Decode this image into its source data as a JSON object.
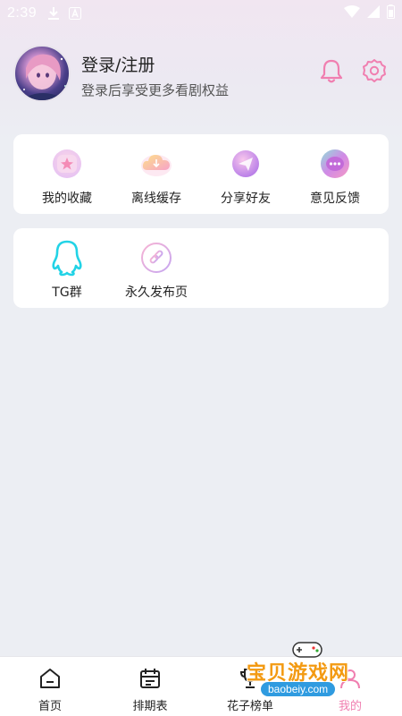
{
  "status_bar": {
    "time": "2:39",
    "icons": [
      "download-icon",
      "a-notification-icon",
      "wifi-icon",
      "signal-icon",
      "battery-icon"
    ]
  },
  "profile": {
    "title": "登录/注册",
    "subtitle": "登录后享受更多看剧权益",
    "icons": [
      "bell-icon",
      "gear-icon"
    ]
  },
  "quick_actions": [
    {
      "label": "我的收藏",
      "icon": "star-favorites-icon"
    },
    {
      "label": "离线缓存",
      "icon": "cloud-download-icon"
    },
    {
      "label": "分享好友",
      "icon": "share-send-icon"
    },
    {
      "label": "意见反馈",
      "icon": "chat-feedback-icon"
    }
  ],
  "links": [
    {
      "label": "TG群",
      "icon": "qq-penguin-icon"
    },
    {
      "label": "永久发布页",
      "icon": "link-icon"
    }
  ],
  "bottom_nav": [
    {
      "label": "首页",
      "icon": "home-icon",
      "active": false
    },
    {
      "label": "排期表",
      "icon": "calendar-icon",
      "active": false
    },
    {
      "label": "花子榜单",
      "icon": "trophy-icon",
      "active": false
    },
    {
      "label": "我的",
      "icon": "profile-icon",
      "active": true
    }
  ],
  "watermark": {
    "text": "宝贝游戏网",
    "url": "baobeiy.com"
  },
  "colors": {
    "accent_pink": "#f07fb0",
    "qq_cyan": "#22d3e6",
    "watermark_orange": "#f39a12"
  }
}
